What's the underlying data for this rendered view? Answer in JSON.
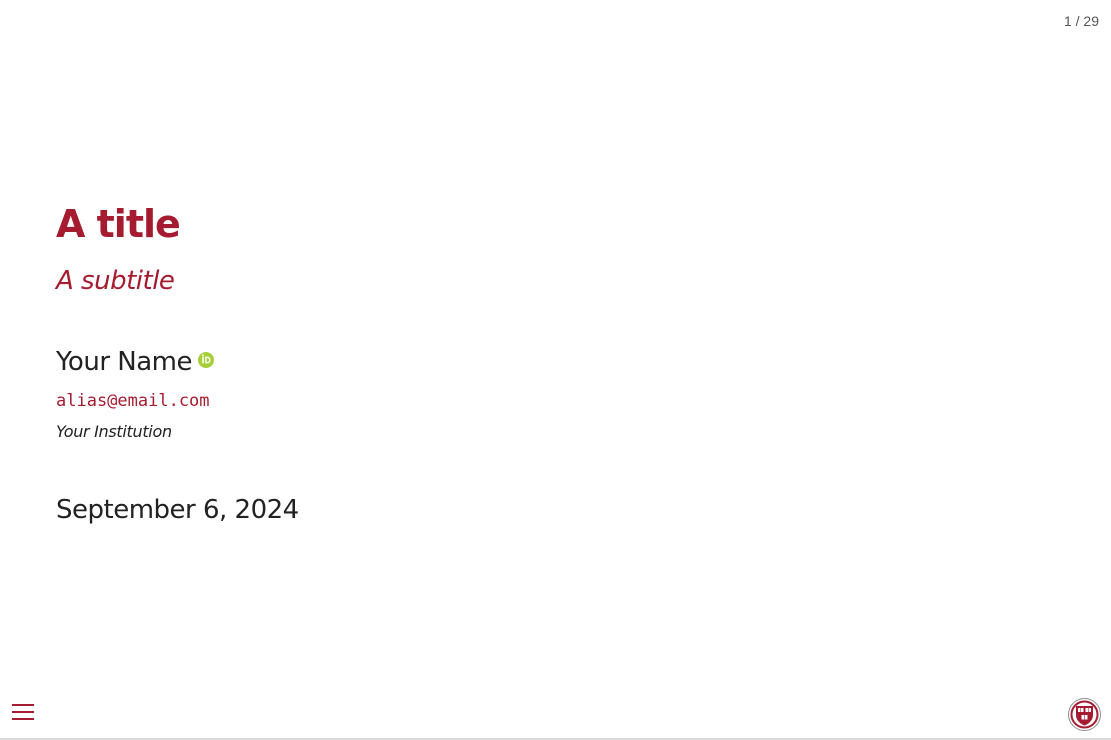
{
  "slide": {
    "number": "1 / 29",
    "title": "A title",
    "subtitle": "A subtitle",
    "author": {
      "name": "Your Name",
      "email": "alias@email.com",
      "institution": "Your Institution"
    },
    "date": "September 6, 2024"
  },
  "controls": {
    "menu_icon": "hamburger-menu-icon",
    "logo_icon": "university-shield-logo"
  },
  "colors": {
    "accent": "#a51c30",
    "text": "#222222",
    "orcid": "#a6ce39"
  }
}
